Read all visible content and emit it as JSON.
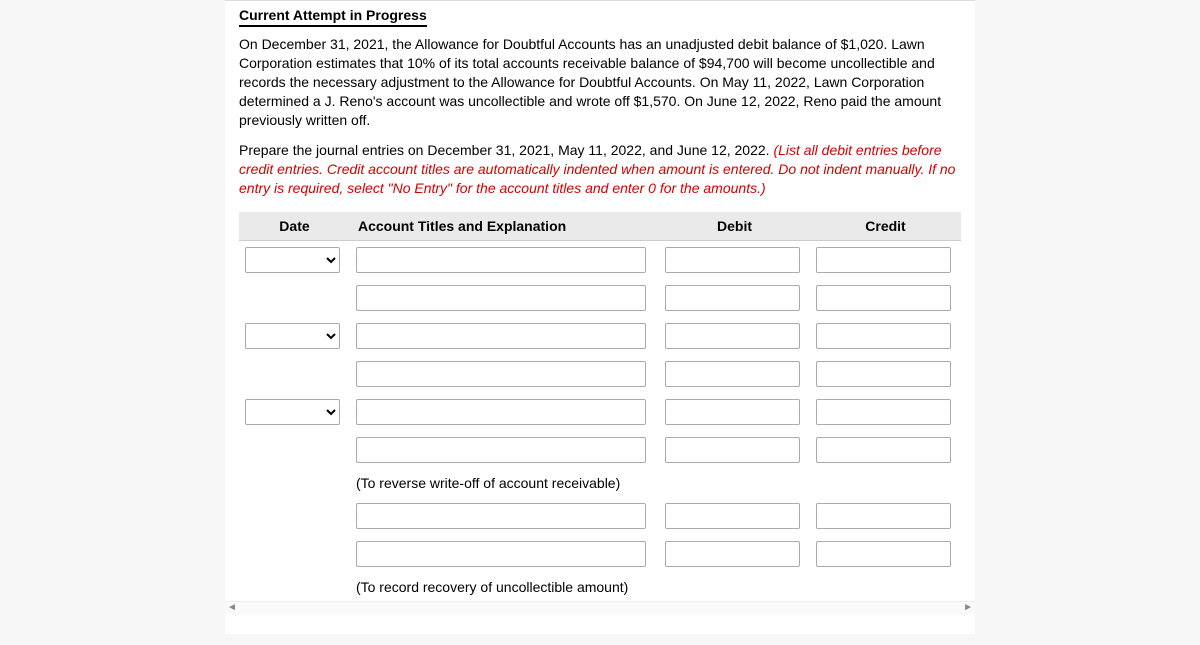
{
  "header": {
    "title": "Current Attempt in Progress"
  },
  "paragraphs": {
    "body": "On December 31, 2021, the Allowance for Doubtful Accounts has an unadjusted debit balance of $1,020. Lawn Corporation estimates that 10% of its total accounts receivable balance of $94,700 will become uncollectible and records the necessary adjustment to the Allowance for Doubtful Accounts. On May 11, 2022, Lawn Corporation determined a J. Reno's account was uncollectible and wrote off $1,570. On June 12, 2022, Reno paid the amount previously written off.",
    "instruction_black": "Prepare the journal entries on December 31, 2021, May 11, 2022, and June 12, 2022. ",
    "instruction_red": "(List all debit entries before credit entries. Credit account titles are automatically indented when amount is entered. Do not indent manually. If no entry is required, select \"No Entry\" for the account titles and enter 0 for the amounts.)"
  },
  "table": {
    "headers": {
      "date": "Date",
      "account": "Account Titles and Explanation",
      "debit": "Debit",
      "credit": "Credit"
    },
    "explanations": {
      "reverse": "(To reverse write-off of account receivable)",
      "recovery": "(To record recovery of uncollectible amount)"
    }
  }
}
